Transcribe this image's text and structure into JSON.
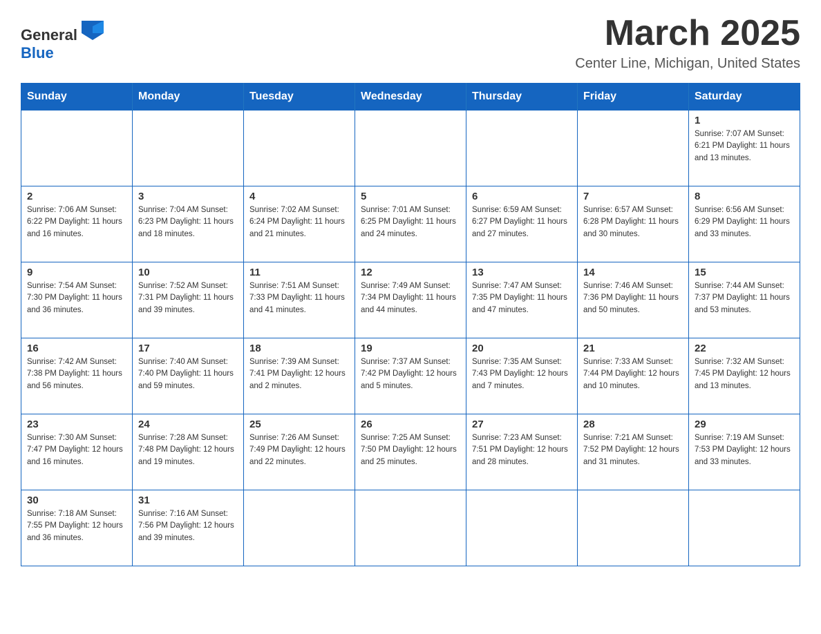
{
  "header": {
    "logo_general": "General",
    "logo_blue": "Blue",
    "title": "March 2025",
    "subtitle": "Center Line, Michigan, United States"
  },
  "weekdays": [
    "Sunday",
    "Monday",
    "Tuesday",
    "Wednesday",
    "Thursday",
    "Friday",
    "Saturday"
  ],
  "weeks": [
    [
      {
        "day": "",
        "info": ""
      },
      {
        "day": "",
        "info": ""
      },
      {
        "day": "",
        "info": ""
      },
      {
        "day": "",
        "info": ""
      },
      {
        "day": "",
        "info": ""
      },
      {
        "day": "",
        "info": ""
      },
      {
        "day": "1",
        "info": "Sunrise: 7:07 AM\nSunset: 6:21 PM\nDaylight: 11 hours\nand 13 minutes."
      }
    ],
    [
      {
        "day": "2",
        "info": "Sunrise: 7:06 AM\nSunset: 6:22 PM\nDaylight: 11 hours\nand 16 minutes."
      },
      {
        "day": "3",
        "info": "Sunrise: 7:04 AM\nSunset: 6:23 PM\nDaylight: 11 hours\nand 18 minutes."
      },
      {
        "day": "4",
        "info": "Sunrise: 7:02 AM\nSunset: 6:24 PM\nDaylight: 11 hours\nand 21 minutes."
      },
      {
        "day": "5",
        "info": "Sunrise: 7:01 AM\nSunset: 6:25 PM\nDaylight: 11 hours\nand 24 minutes."
      },
      {
        "day": "6",
        "info": "Sunrise: 6:59 AM\nSunset: 6:27 PM\nDaylight: 11 hours\nand 27 minutes."
      },
      {
        "day": "7",
        "info": "Sunrise: 6:57 AM\nSunset: 6:28 PM\nDaylight: 11 hours\nand 30 minutes."
      },
      {
        "day": "8",
        "info": "Sunrise: 6:56 AM\nSunset: 6:29 PM\nDaylight: 11 hours\nand 33 minutes."
      }
    ],
    [
      {
        "day": "9",
        "info": "Sunrise: 7:54 AM\nSunset: 7:30 PM\nDaylight: 11 hours\nand 36 minutes."
      },
      {
        "day": "10",
        "info": "Sunrise: 7:52 AM\nSunset: 7:31 PM\nDaylight: 11 hours\nand 39 minutes."
      },
      {
        "day": "11",
        "info": "Sunrise: 7:51 AM\nSunset: 7:33 PM\nDaylight: 11 hours\nand 41 minutes."
      },
      {
        "day": "12",
        "info": "Sunrise: 7:49 AM\nSunset: 7:34 PM\nDaylight: 11 hours\nand 44 minutes."
      },
      {
        "day": "13",
        "info": "Sunrise: 7:47 AM\nSunset: 7:35 PM\nDaylight: 11 hours\nand 47 minutes."
      },
      {
        "day": "14",
        "info": "Sunrise: 7:46 AM\nSunset: 7:36 PM\nDaylight: 11 hours\nand 50 minutes."
      },
      {
        "day": "15",
        "info": "Sunrise: 7:44 AM\nSunset: 7:37 PM\nDaylight: 11 hours\nand 53 minutes."
      }
    ],
    [
      {
        "day": "16",
        "info": "Sunrise: 7:42 AM\nSunset: 7:38 PM\nDaylight: 11 hours\nand 56 minutes."
      },
      {
        "day": "17",
        "info": "Sunrise: 7:40 AM\nSunset: 7:40 PM\nDaylight: 11 hours\nand 59 minutes."
      },
      {
        "day": "18",
        "info": "Sunrise: 7:39 AM\nSunset: 7:41 PM\nDaylight: 12 hours\nand 2 minutes."
      },
      {
        "day": "19",
        "info": "Sunrise: 7:37 AM\nSunset: 7:42 PM\nDaylight: 12 hours\nand 5 minutes."
      },
      {
        "day": "20",
        "info": "Sunrise: 7:35 AM\nSunset: 7:43 PM\nDaylight: 12 hours\nand 7 minutes."
      },
      {
        "day": "21",
        "info": "Sunrise: 7:33 AM\nSunset: 7:44 PM\nDaylight: 12 hours\nand 10 minutes."
      },
      {
        "day": "22",
        "info": "Sunrise: 7:32 AM\nSunset: 7:45 PM\nDaylight: 12 hours\nand 13 minutes."
      }
    ],
    [
      {
        "day": "23",
        "info": "Sunrise: 7:30 AM\nSunset: 7:47 PM\nDaylight: 12 hours\nand 16 minutes."
      },
      {
        "day": "24",
        "info": "Sunrise: 7:28 AM\nSunset: 7:48 PM\nDaylight: 12 hours\nand 19 minutes."
      },
      {
        "day": "25",
        "info": "Sunrise: 7:26 AM\nSunset: 7:49 PM\nDaylight: 12 hours\nand 22 minutes."
      },
      {
        "day": "26",
        "info": "Sunrise: 7:25 AM\nSunset: 7:50 PM\nDaylight: 12 hours\nand 25 minutes."
      },
      {
        "day": "27",
        "info": "Sunrise: 7:23 AM\nSunset: 7:51 PM\nDaylight: 12 hours\nand 28 minutes."
      },
      {
        "day": "28",
        "info": "Sunrise: 7:21 AM\nSunset: 7:52 PM\nDaylight: 12 hours\nand 31 minutes."
      },
      {
        "day": "29",
        "info": "Sunrise: 7:19 AM\nSunset: 7:53 PM\nDaylight: 12 hours\nand 33 minutes."
      }
    ],
    [
      {
        "day": "30",
        "info": "Sunrise: 7:18 AM\nSunset: 7:55 PM\nDaylight: 12 hours\nand 36 minutes."
      },
      {
        "day": "31",
        "info": "Sunrise: 7:16 AM\nSunset: 7:56 PM\nDaylight: 12 hours\nand 39 minutes."
      },
      {
        "day": "",
        "info": ""
      },
      {
        "day": "",
        "info": ""
      },
      {
        "day": "",
        "info": ""
      },
      {
        "day": "",
        "info": ""
      },
      {
        "day": "",
        "info": ""
      }
    ]
  ]
}
